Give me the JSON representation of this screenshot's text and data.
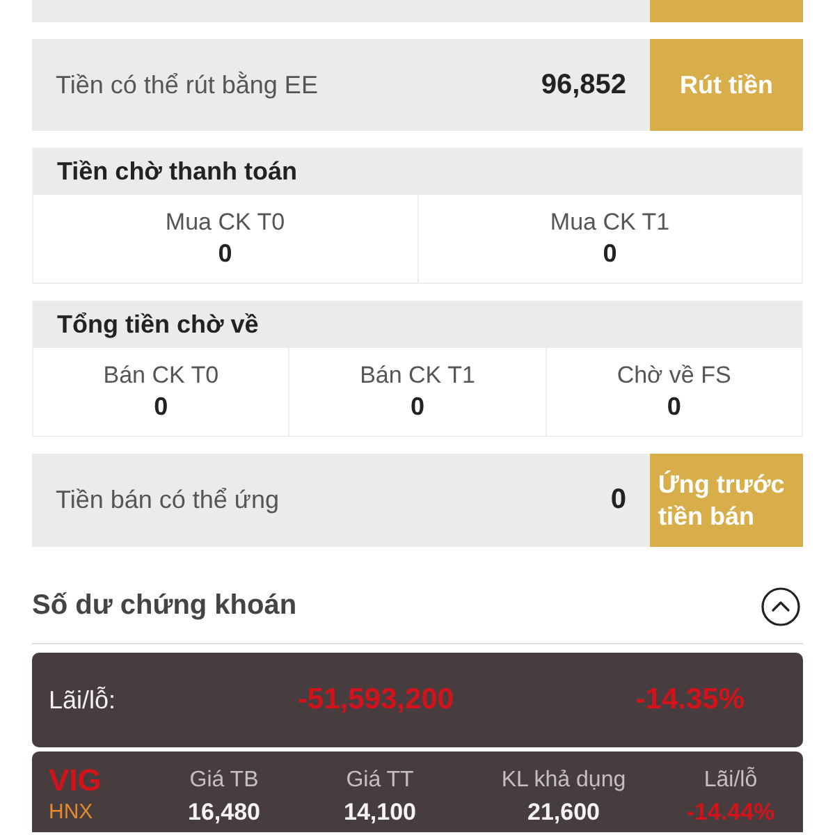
{
  "withdraw_row": {
    "label": "Tiền có thể rút bằng EE",
    "value": "96,852",
    "button": "Rút tiền"
  },
  "pending_payment": {
    "title": "Tiền chờ thanh toán",
    "cells": [
      {
        "label": "Mua CK T0",
        "value": "0"
      },
      {
        "label": "Mua CK T1",
        "value": "0"
      }
    ]
  },
  "pending_incoming": {
    "title": "Tổng tiền chờ về",
    "cells": [
      {
        "label": "Bán CK T0",
        "value": "0"
      },
      {
        "label": "Bán CK T1",
        "value": "0"
      },
      {
        "label": "Chờ về FS",
        "value": "0"
      }
    ]
  },
  "advance_row": {
    "label": "Tiền bán có thể ứng",
    "value": "0",
    "button": "Ứng trước tiền bán"
  },
  "holdings": {
    "title": "Số dư chứng khoán",
    "expanded": true,
    "summary": {
      "label": "Lãi/lỗ:",
      "amount": "-51,593,200",
      "percent": "-14.35%",
      "loss": true
    },
    "stocks": [
      {
        "symbol": "VIG",
        "exchange": "HNX",
        "columns": [
          {
            "label": "Giá TB",
            "value": "16,480",
            "loss": false
          },
          {
            "label": "Giá TT",
            "value": "14,100",
            "loss": false
          },
          {
            "label": "KL khả dụng",
            "value": "21,600",
            "loss": false
          },
          {
            "label": "Lãi/lỗ",
            "value": "-14.44%",
            "loss": true
          }
        ]
      }
    ]
  }
}
